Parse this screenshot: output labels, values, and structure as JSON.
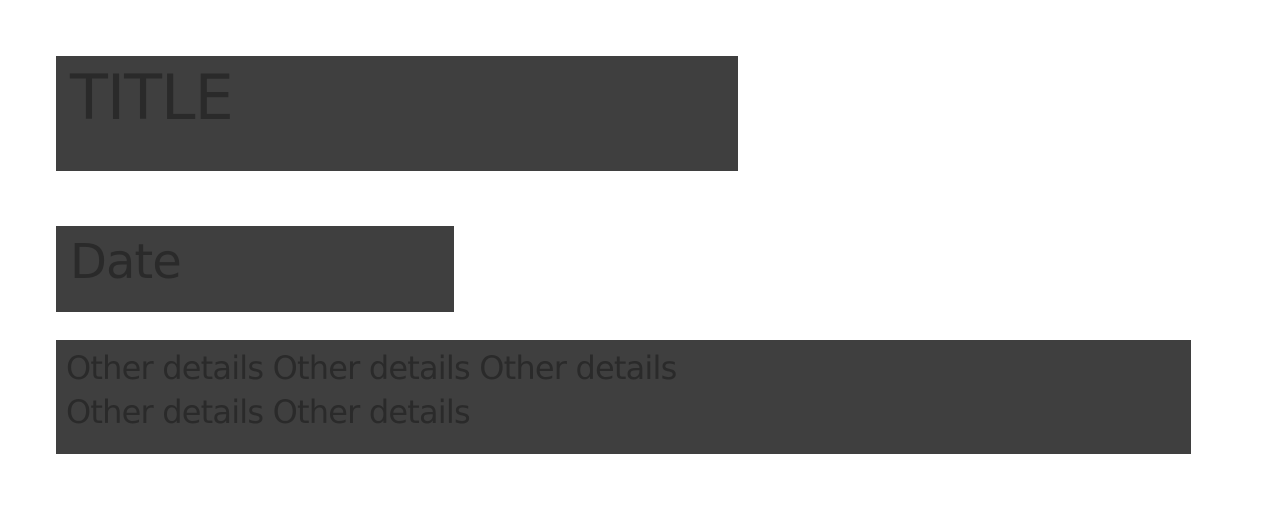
{
  "title": "TITLE",
  "date": "Date",
  "details": "Other details Other details Other details Other details Other details",
  "colors": {
    "block": "#3f3f3f",
    "text": "#2a2a2a",
    "background": "#ffffff"
  }
}
